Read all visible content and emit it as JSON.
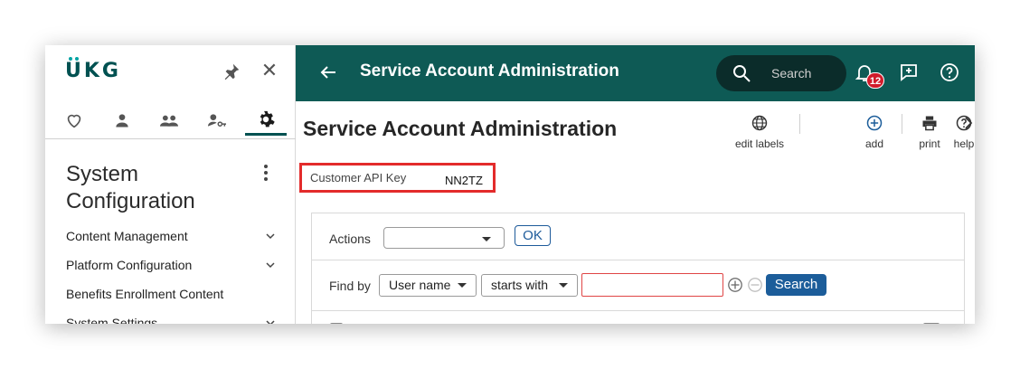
{
  "sidebar": {
    "logo": "UKG",
    "title": "System Configuration",
    "menu": [
      {
        "label": "Content Management",
        "has_chevron": true
      },
      {
        "label": "Platform Configuration",
        "has_chevron": true
      },
      {
        "label": "Benefits Enrollment Content",
        "has_chevron": false
      },
      {
        "label": "System Settings",
        "has_chevron": true
      }
    ],
    "tabs": [
      "heart-icon",
      "person-icon",
      "people-icon",
      "person-key-icon",
      "gear-icon"
    ]
  },
  "header": {
    "title": "Service Account Administration",
    "search_placeholder": "Search",
    "notification_count": "12"
  },
  "page": {
    "title": "Service Account Administration",
    "toolbar": {
      "edit_labels": "edit labels",
      "add": "add",
      "print": "print",
      "help": "help"
    },
    "api_key_label": "Customer API Key",
    "api_key_value": "NN2TZ",
    "actions_label": "Actions",
    "actions_value": "",
    "ok_label": "OK",
    "find_by_label": "Find by",
    "find_field": "User name",
    "find_operator": "starts with",
    "find_value": "",
    "search_button": "Search"
  },
  "colors": {
    "header_bg": "#0e5a55",
    "accent_blue": "#1c5d9a",
    "highlight_red": "#e32b2b",
    "badge_red": "#d11b2b"
  }
}
